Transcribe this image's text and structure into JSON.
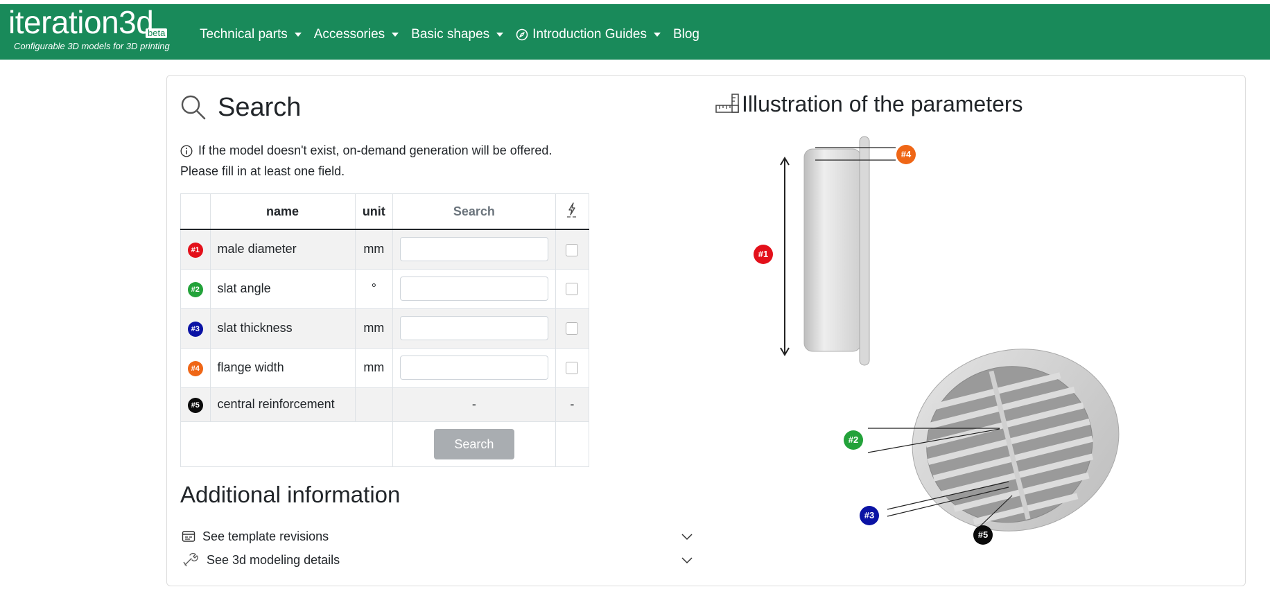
{
  "brand": {
    "name": "iteration3d",
    "beta": "beta",
    "tagline": "Configurable 3D models for 3D printing"
  },
  "nav": {
    "items": [
      {
        "label": "Technical parts",
        "dropdown": true
      },
      {
        "label": "Accessories",
        "dropdown": true
      },
      {
        "label": "Basic shapes",
        "dropdown": true
      },
      {
        "label": "Introduction Guides",
        "dropdown": true,
        "icon": "compass-icon"
      },
      {
        "label": "Blog",
        "dropdown": false
      }
    ]
  },
  "search": {
    "title": "Search",
    "info": "If the model doesn't exist, on-demand generation will be offered.",
    "hint": "Please fill in at least one field.",
    "table": {
      "headers": {
        "name": "name",
        "unit": "unit",
        "search": "Search"
      },
      "rows": [
        {
          "num": "#1",
          "color": "#e3101a",
          "name": "male diameter",
          "unit": "mm",
          "value": "",
          "input": true
        },
        {
          "num": "#2",
          "color": "#23a23a",
          "name": "slat angle",
          "unit": "°",
          "value": "",
          "input": true
        },
        {
          "num": "#3",
          "color": "#0a12a4",
          "name": "slat thickness",
          "unit": "mm",
          "value": "",
          "input": true
        },
        {
          "num": "#4",
          "color": "#ef6616",
          "name": "flange width",
          "unit": "mm",
          "value": "",
          "input": true
        },
        {
          "num": "#5",
          "color": "#0b0b0b",
          "name": "central reinforcement",
          "unit": "",
          "search_placeholder": "-",
          "check_placeholder": "-",
          "input": false
        }
      ],
      "button": "Search"
    }
  },
  "additional": {
    "title": "Additional information",
    "items": [
      {
        "label": "See template revisions",
        "icon": "calendar-icon"
      },
      {
        "label": "See 3d modeling details",
        "icon": "wrench-icon"
      }
    ]
  },
  "illustration": {
    "title": "Illustration of the parameters",
    "badges": [
      {
        "num": "#4",
        "color": "#ef6616"
      },
      {
        "num": "#1",
        "color": "#e3101a"
      },
      {
        "num": "#2",
        "color": "#23a23a"
      },
      {
        "num": "#3",
        "color": "#0a12a4"
      },
      {
        "num": "#5",
        "color": "#0b0b0b"
      }
    ]
  },
  "colors": {
    "navbar": "#198a5a",
    "button": "#a9adb1"
  }
}
